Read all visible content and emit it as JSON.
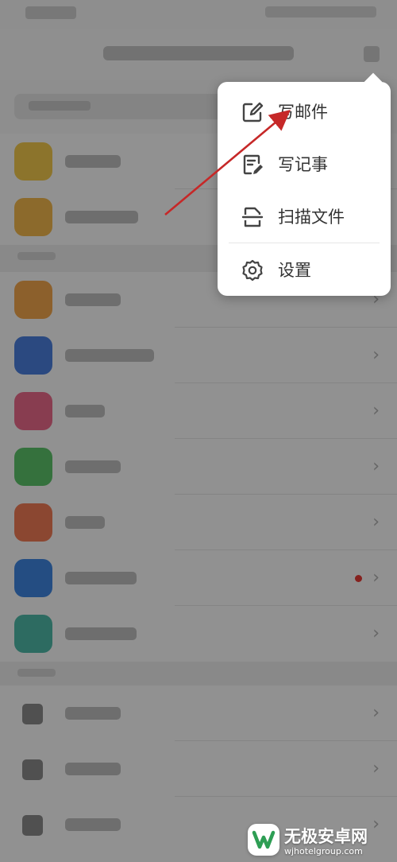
{
  "menu": {
    "items": [
      {
        "label": "写邮件",
        "icon": "compose-mail-icon"
      },
      {
        "label": "写记事",
        "icon": "write-note-icon"
      },
      {
        "label": "扫描文件",
        "icon": "scan-document-icon"
      },
      {
        "label": "设置",
        "icon": "settings-gear-icon"
      }
    ]
  },
  "background_list": {
    "note": "",
    "has_new_dot_row": 7
  },
  "colors": {
    "overlay": "#000000",
    "annotation_arrow": "#c62828",
    "unread_dot": "#e53935",
    "icon_yellow": "#f2c94c",
    "icon_orange": "#f2a64c",
    "icon_blue": "#4a7fdc",
    "icon_pink": "#ea6a8a",
    "icon_green": "#5cc36a",
    "icon_red": "#ef7a55",
    "icon_teal": "#4fb9a8"
  },
  "watermark": {
    "brand": "无极安卓网",
    "url": "wjhotelgroup.com"
  }
}
